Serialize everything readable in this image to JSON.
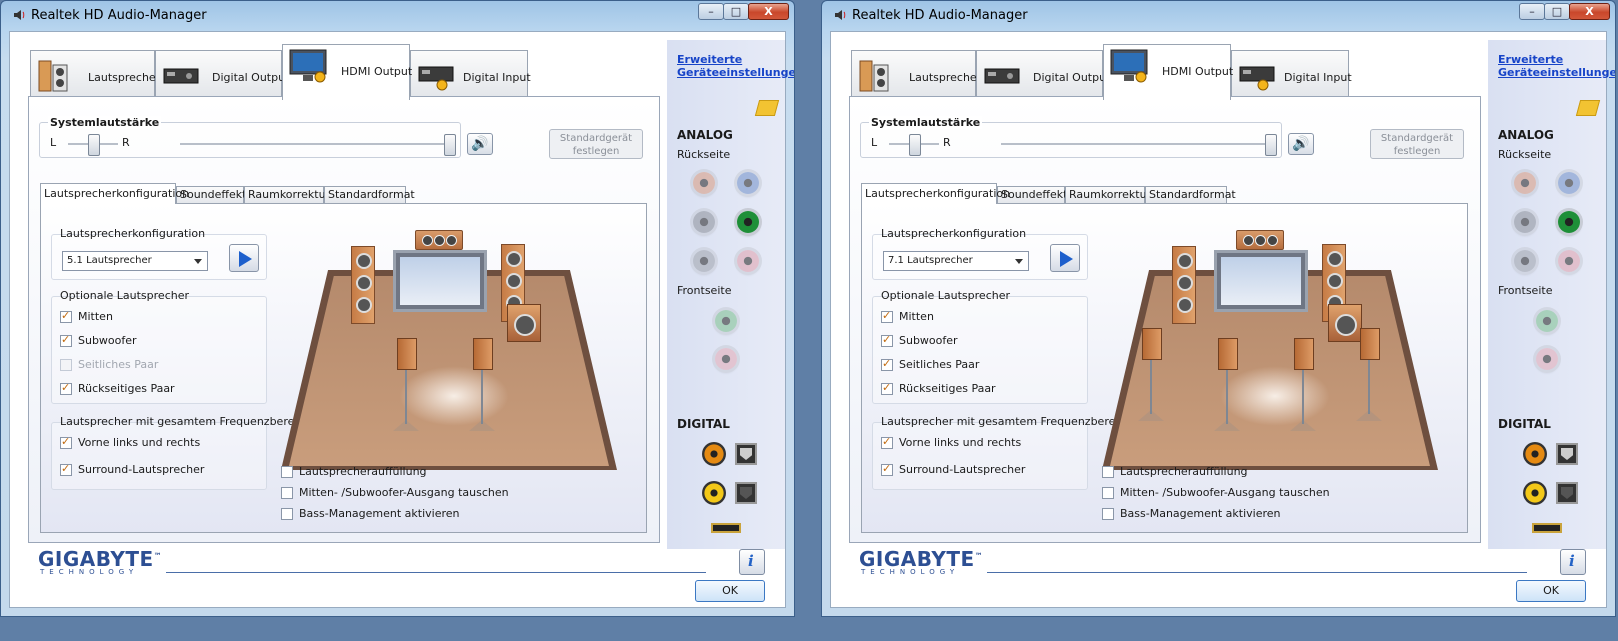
{
  "windows": [
    {
      "title": "Realtek HD Audio-Manager",
      "titlebar_buttons": {
        "minimize": "–",
        "maximize": "□",
        "close": "X"
      },
      "tabs": [
        "Lautsprecher",
        "Digital Output",
        "HDMI Output",
        "Digital Input"
      ],
      "active_tab": "HDMI Output",
      "system_volume": {
        "label": "Systemlautstärke",
        "left": "L",
        "right": "R",
        "level": 1.0,
        "balance": 0.5
      },
      "default_device_button": "Standardgerät festlegen",
      "subtabs": [
        "Lautsprecherkonfiguration",
        "Soundeffekt",
        "Raumkorrektur",
        "Standardformat"
      ],
      "speaker_config": {
        "label": "Lautsprecherkonfiguration",
        "selected": "5.1 Lautsprecher"
      },
      "optional_speakers": {
        "label": "Optionale Lautsprecher",
        "items": [
          {
            "label": "Mitten",
            "checked": true,
            "enabled": true
          },
          {
            "label": "Subwoofer",
            "checked": true,
            "enabled": true
          },
          {
            "label": "Seitliches Paar",
            "checked": false,
            "enabled": false
          },
          {
            "label": "Rückseitiges Paar",
            "checked": true,
            "enabled": true
          }
        ]
      },
      "fullrange": {
        "label": "Lautsprecher mit gesamtem Frequenzbereich",
        "items": [
          {
            "label": "Vorne links und rechts",
            "checked": true
          },
          {
            "label": "Surround-Lautsprecher",
            "checked": true
          }
        ]
      },
      "bottom_options": [
        {
          "label": "Lautsprecherauffüllung",
          "checked": false
        },
        {
          "label": "Mitten- /Subwoofer-Ausgang tauschen",
          "checked": false
        },
        {
          "label": "Bass-Management aktivieren",
          "checked": false
        }
      ],
      "side": {
        "link": "Erweiterte Geräteeinstellungen",
        "analog": "ANALOG",
        "back": "Rückseite",
        "front": "Frontseite",
        "digital": "DIGITAL",
        "jack_colors_back": [
          "#d99a7e",
          "#6f8fc8",
          "#8b8f98",
          "#1e8f38",
          "#9ea2aa",
          "#e0a0ad"
        ],
        "jack_colors_front": [
          "#7cc08e",
          "#e3aab5"
        ]
      },
      "brand": {
        "name": "GIGABYTE",
        "tagline": "TECHNOLOGY",
        "trademark": "™"
      },
      "ok": "OK",
      "info_icon": "i"
    },
    {
      "title": "Realtek HD Audio-Manager",
      "titlebar_buttons": {
        "minimize": "–",
        "maximize": "□",
        "close": "X"
      },
      "tabs": [
        "Lautsprecher",
        "Digital Output",
        "HDMI Output",
        "Digital Input"
      ],
      "active_tab": "HDMI Output",
      "system_volume": {
        "label": "Systemlautstärke",
        "left": "L",
        "right": "R",
        "level": 1.0,
        "balance": 0.5
      },
      "default_device_button": "Standardgerät festlegen",
      "subtabs": [
        "Lautsprecherkonfiguration",
        "Soundeffekt",
        "Raumkorrektur",
        "Standardformat"
      ],
      "speaker_config": {
        "label": "Lautsprecherkonfiguration",
        "selected": "7.1 Lautsprecher"
      },
      "optional_speakers": {
        "label": "Optionale Lautsprecher",
        "items": [
          {
            "label": "Mitten",
            "checked": true,
            "enabled": true
          },
          {
            "label": "Subwoofer",
            "checked": true,
            "enabled": true
          },
          {
            "label": "Seitliches Paar",
            "checked": true,
            "enabled": true
          },
          {
            "label": "Rückseitiges Paar",
            "checked": true,
            "enabled": true
          }
        ]
      },
      "fullrange": {
        "label": "Lautsprecher mit gesamtem Frequenzbereich",
        "items": [
          {
            "label": "Vorne links und rechts",
            "checked": true
          },
          {
            "label": "Surround-Lautsprecher",
            "checked": true
          }
        ]
      },
      "bottom_options": [
        {
          "label": "Lautsprecherauffüllung",
          "checked": false
        },
        {
          "label": "Mitten- /Subwoofer-Ausgang tauschen",
          "checked": false
        },
        {
          "label": "Bass-Management aktivieren",
          "checked": false
        }
      ],
      "side": {
        "link": "Erweiterte Geräteeinstellungen",
        "analog": "ANALOG",
        "back": "Rückseite",
        "front": "Frontseite",
        "digital": "DIGITAL",
        "jack_colors_back": [
          "#d99a7e",
          "#6f8fc8",
          "#8b8f98",
          "#1e8f38",
          "#9ea2aa",
          "#e0a0ad"
        ],
        "jack_colors_front": [
          "#7cc08e",
          "#e3aab5"
        ]
      },
      "brand": {
        "name": "GIGABYTE",
        "tagline": "TECHNOLOGY",
        "trademark": "™"
      },
      "ok": "OK",
      "info_icon": "i"
    }
  ]
}
